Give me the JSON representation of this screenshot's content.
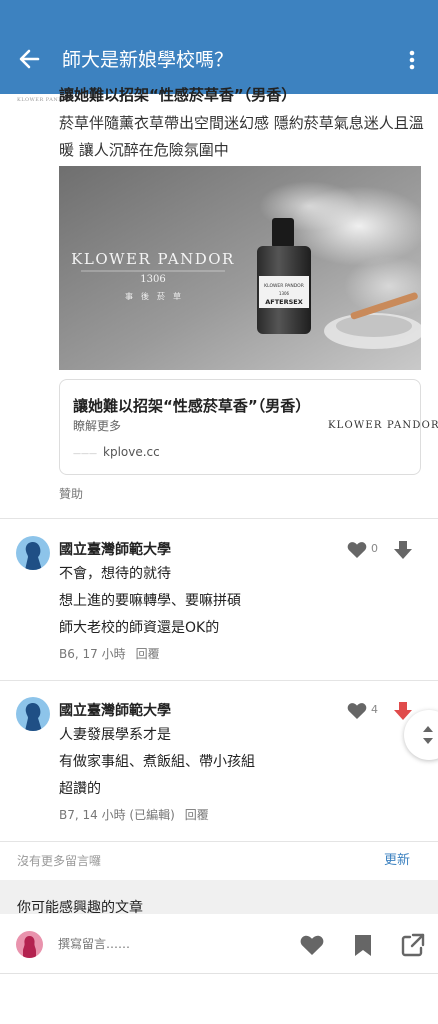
{
  "header": {
    "title": "師大是新娘學校嗎？",
    "color": "#3d82c0"
  },
  "ad": {
    "tiny_logo": "KLOWER PANDOR",
    "title": "讓她難以招架“性感菸草香”（男香）",
    "body": "菸草伴隨薰衣草帶出空間迷幻感 隱約菸草氣息迷人且溫暖 讓人沉醉在危險氛圍中",
    "image": {
      "brand": "KLOWER PANDOR",
      "number": "1306",
      "subtitle": "事　後　菸　草",
      "bottle_brand": "KLOWER PANDOR",
      "bottle_number": "1306",
      "bottle_name": "AFTERSEX"
    },
    "card": {
      "title": "讓她難以招架“性感菸草香”（男香）",
      "more": "瞭解更多",
      "domain": "kplove.cc",
      "brand": "KLOWER PANDOR"
    },
    "sponsored": "贊助"
  },
  "comments": [
    {
      "author": "國立臺灣師範大學",
      "likes": "0",
      "lines": [
        "不會，想待的就待",
        "想上進的要嘛轉學、要嘛拼碩",
        "師大老校的師資還是OK的"
      ],
      "meta": "B6, 17 小時",
      "reply": "回覆",
      "downvoted": false
    },
    {
      "author": "國立臺灣師範大學",
      "likes": "4",
      "lines": [
        "人妻發展學系才是",
        "有做家事組、煮飯組、帶小孩組",
        "超讚的"
      ],
      "meta": "B7, 14 小時 (已編輯)",
      "reply": "回覆",
      "downvoted": true
    }
  ],
  "footer": {
    "no_more": "沒有更多留言囉",
    "refresh": "更新",
    "related": "你可能感興趣的文章"
  },
  "bottombar": {
    "placeholder": "撰寫留言……"
  },
  "icons": {
    "back": "arrow-left-icon",
    "more": "more-vertical-icon",
    "like": "heart-icon",
    "down": "arrow-down-icon",
    "bookmark": "bookmark-icon",
    "share": "share-icon",
    "scroll": "scroll-up-down-icon"
  },
  "colors": {
    "accent": "#3d82c0",
    "downvote_active": "#e04b4b",
    "icon_grey": "#666666",
    "avatar_blue": "#8dc4ea",
    "avatar_pink": "#e993ad"
  }
}
